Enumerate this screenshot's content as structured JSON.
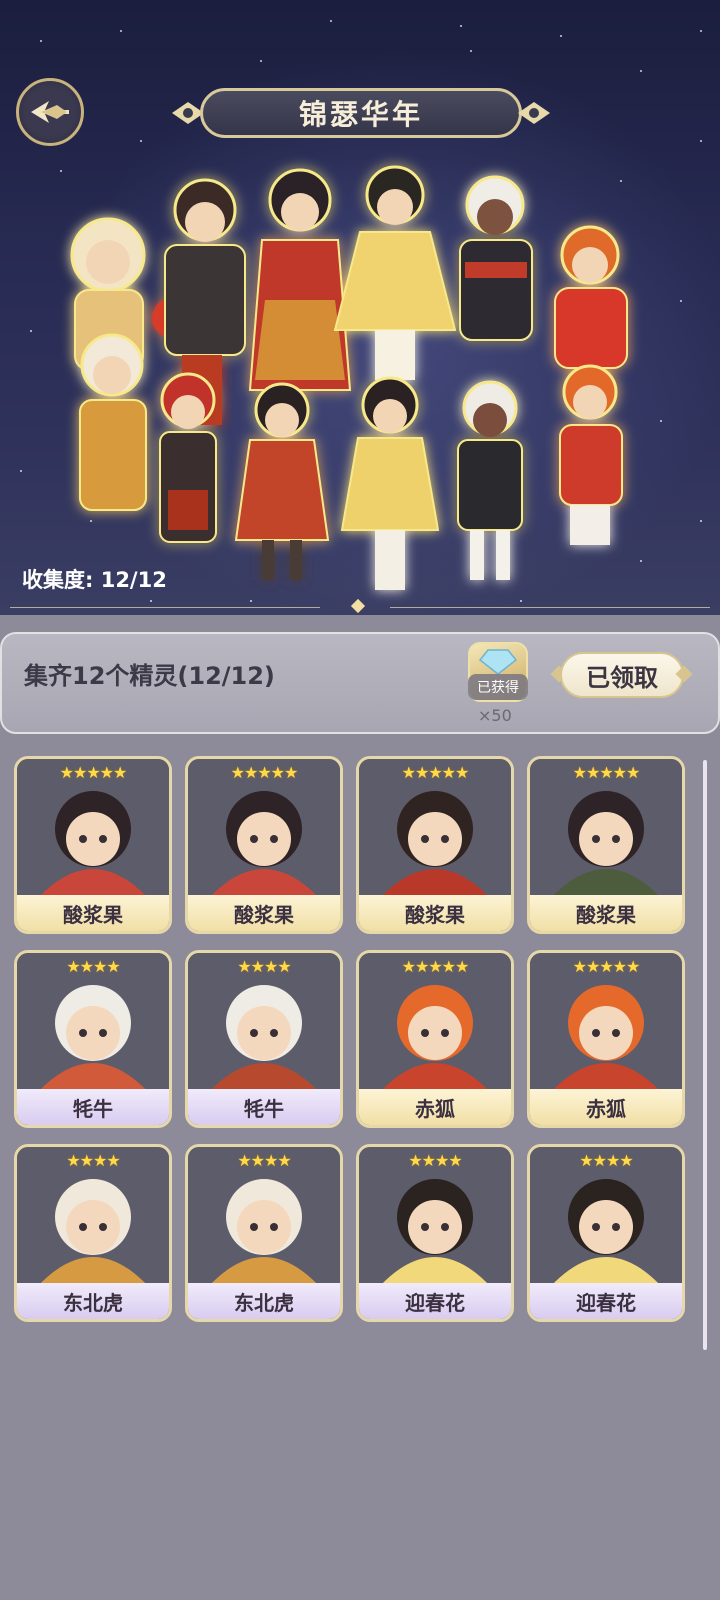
{
  "header": {
    "title": "锦瑟华年",
    "collection_label": "收集度: 12/12"
  },
  "task": {
    "text": "集齐12个精灵(12/12)",
    "reward_badge": "已获得",
    "reward_qty": "×50",
    "claim_button": "已领取"
  },
  "icons": {
    "back": "back-arrow-icon",
    "reward": "crystal-icon",
    "star": "star-icon"
  },
  "colors": {
    "gold_accent": "#e6d8a8",
    "star": "#ffd94a",
    "name_gold": "#f1dfa6",
    "name_purple": "#d8ccf0"
  },
  "cards": [
    {
      "name": "酸浆果",
      "stars": "★★★★★",
      "style": "gold"
    },
    {
      "name": "酸浆果",
      "stars": "★★★★★",
      "style": "gold"
    },
    {
      "name": "酸浆果",
      "stars": "★★★★★",
      "style": "gold"
    },
    {
      "name": "酸浆果",
      "stars": "★★★★★",
      "style": "gold"
    },
    {
      "name": "牦牛",
      "stars": "★★★★",
      "style": "purple"
    },
    {
      "name": "牦牛",
      "stars": "★★★★",
      "style": "purple"
    },
    {
      "name": "赤狐",
      "stars": "★★★★★",
      "style": "gold"
    },
    {
      "name": "赤狐",
      "stars": "★★★★★",
      "style": "gold"
    },
    {
      "name": "东北虎",
      "stars": "★★★★",
      "style": "purple"
    },
    {
      "name": "东北虎",
      "stars": "★★★★",
      "style": "purple"
    },
    {
      "name": "迎春花",
      "stars": "★★★★",
      "style": "purple"
    },
    {
      "name": "迎春花",
      "stars": "★★★★",
      "style": "purple"
    }
  ]
}
